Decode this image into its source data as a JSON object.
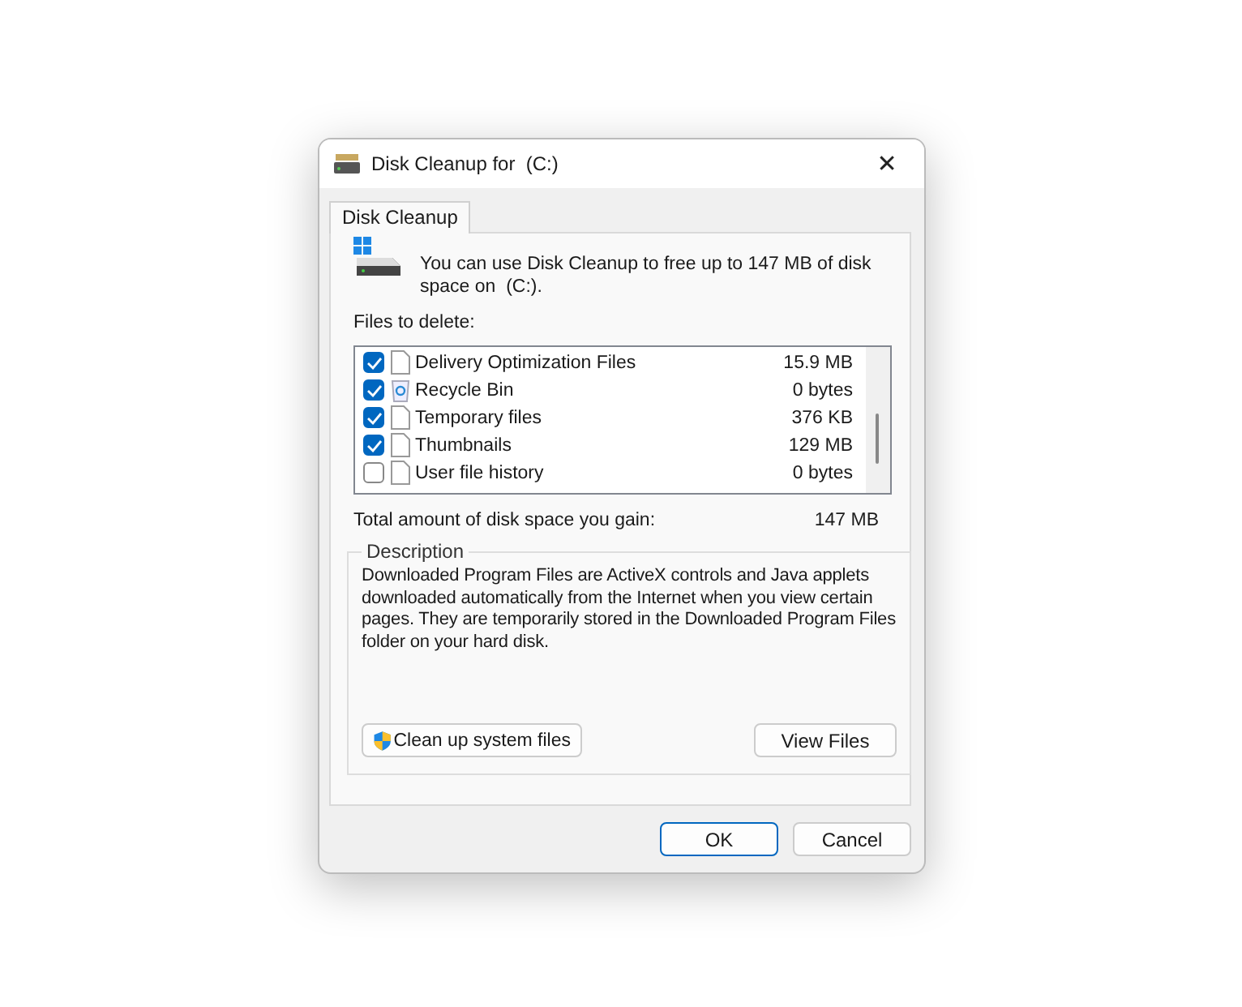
{
  "window": {
    "title": "Disk Cleanup for  (C:)",
    "close": "✕"
  },
  "tabs": [
    {
      "label": "Disk Cleanup",
      "selected": true
    }
  ],
  "intro": "You can use Disk Cleanup to free up to 147 MB of disk space on  (C:).",
  "files_label": "Files to delete:",
  "files": [
    {
      "name": "Delivery Optimization Files",
      "size": "15.9 MB",
      "checked": true,
      "kind": "file"
    },
    {
      "name": "Recycle Bin",
      "size": "0 bytes",
      "checked": true,
      "kind": "recycle"
    },
    {
      "name": "Temporary files",
      "size": "376 KB",
      "checked": true,
      "kind": "file"
    },
    {
      "name": "Thumbnails",
      "size": "129 MB",
      "checked": true,
      "kind": "file"
    },
    {
      "name": "User file history",
      "size": "0 bytes",
      "checked": false,
      "kind": "file"
    }
  ],
  "total": {
    "label": "Total amount of disk space you gain:",
    "value": "147 MB"
  },
  "description": {
    "title": "Description",
    "text": "Downloaded Program Files are ActiveX controls and Java applets downloaded automatically from the Internet when you view certain pages. They are temporarily stored in the Downloaded Program Files folder on your hard disk."
  },
  "clean_system_button": "Clean up system files",
  "view_files_button": "View Files",
  "buttons": [
    {
      "label": "OK",
      "default": true
    },
    {
      "label": "Cancel",
      "default": false
    }
  ]
}
